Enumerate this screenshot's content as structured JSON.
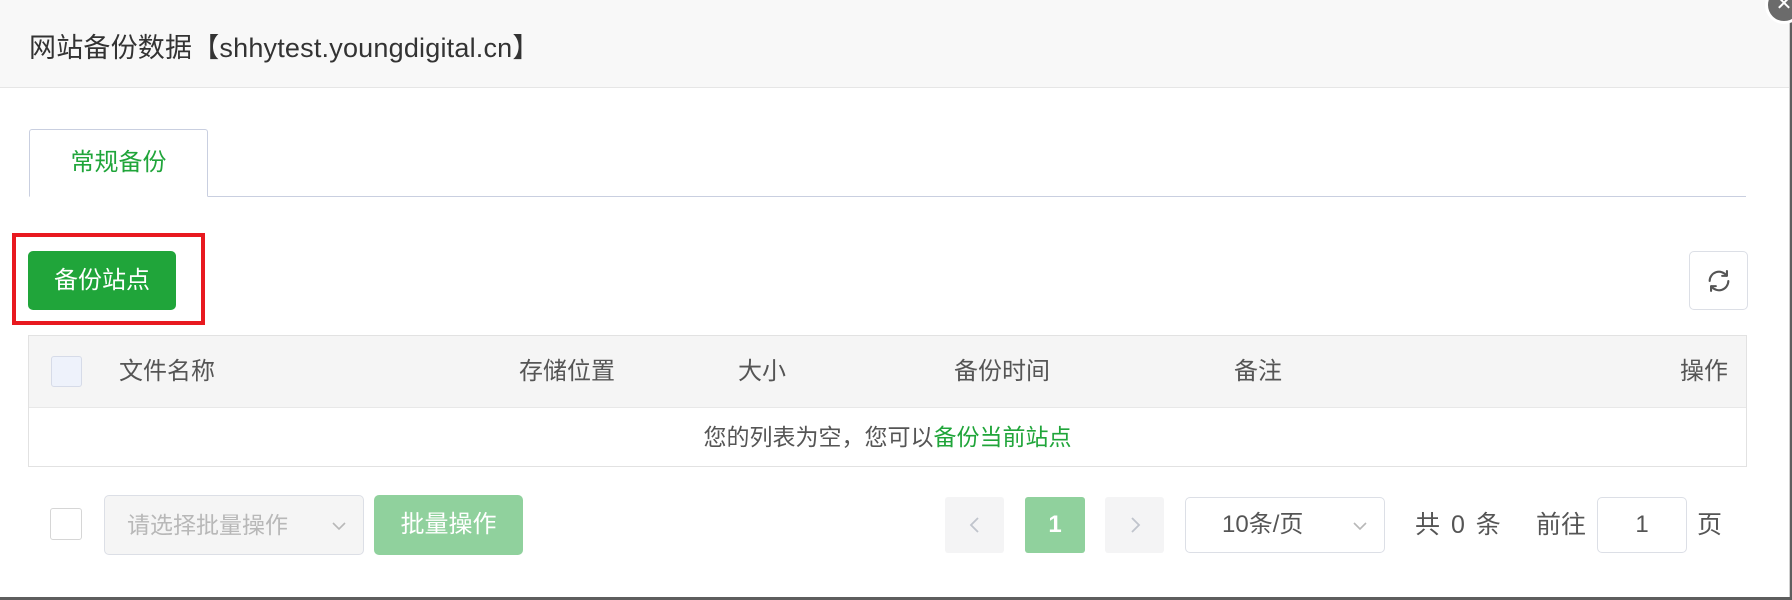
{
  "dialog": {
    "title": "网站备份数据【shhytest.youngdigital.cn】",
    "close_icon": "close-icon"
  },
  "tabs": [
    {
      "label": "常规备份",
      "active": true
    }
  ],
  "toolbar": {
    "backup_button_label": "备份站点",
    "refresh_icon": "refresh-icon"
  },
  "table": {
    "columns": [
      "文件名称",
      "存储位置",
      "大小",
      "备份时间",
      "备注",
      "操作"
    ],
    "rows": [],
    "empty_text": "您的列表为空，您可以",
    "empty_link": "备份当前站点"
  },
  "footer": {
    "batch_select_placeholder": "请选择批量操作",
    "batch_button_label": "批量操作",
    "pagination": {
      "current_page": "1",
      "page_size_label": "10条/页",
      "total_text": "共 0 条",
      "goto_label": "前往",
      "goto_value": "1",
      "page_suffix": "页"
    }
  },
  "colors": {
    "accent": "#20a53a",
    "accent_disabled": "#90d19d",
    "highlight": "#e8191f"
  }
}
